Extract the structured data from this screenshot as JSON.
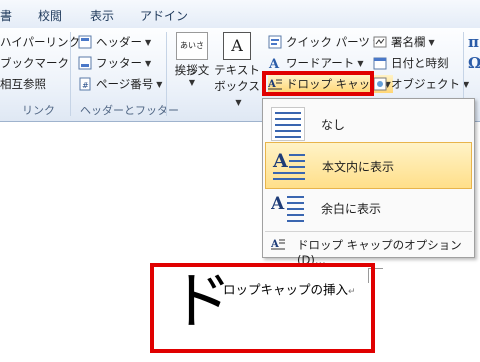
{
  "tabs": [
    "書",
    "校閲",
    "表示",
    "アドイン"
  ],
  "ribbon": {
    "links_group": {
      "items": [
        "ハイパーリンク",
        "ブックマーク",
        "相互参照"
      ],
      "label": "リンク"
    },
    "header_footer_group": {
      "items": [
        "ヘッダー",
        "フッター",
        "ページ番号"
      ],
      "label": "ヘッダーとフッター"
    },
    "text_group": {
      "greeting_label": "挨拶文",
      "textbox_label_1": "テキスト",
      "textbox_label_2": "ボックス",
      "quick_parts": "クイック パーツ",
      "wordart": "ワードアート",
      "drop_cap": "ドロップ キャップ",
      "signature_line": "署名欄",
      "date_time": "日付と時刻",
      "object": "オブジェクト",
      "greeting_icon_text": "あいさつ",
      "textbox_icon_text": "A"
    },
    "symbols_group": {
      "equation_glyph": "π",
      "symbol_glyph": "Ω"
    }
  },
  "dropdown": {
    "items": [
      {
        "label": "なし",
        "icon": "drop-cap-none-icon",
        "selected": false
      },
      {
        "label": "本文内に表示",
        "icon": "drop-cap-dropped-icon",
        "selected": true
      },
      {
        "label": "余白に表示",
        "icon": "drop-cap-in-margin-icon",
        "selected": false
      }
    ],
    "options": "ドロップ キャップのオプション(D)...",
    "icon_letter": "A"
  },
  "document": {
    "drop_cap_letter": "ド",
    "body_text": "ロップキャップの挿入",
    "paragraph_mark": "↵"
  },
  "colors": {
    "highlight": "#e00000",
    "selected_item": "#ffdf8a",
    "ribbon": "#eef3fa"
  }
}
